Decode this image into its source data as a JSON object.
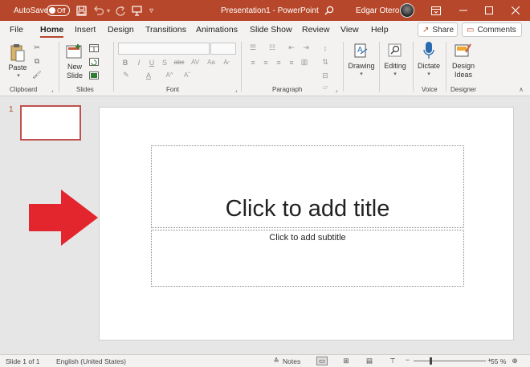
{
  "titlebar": {
    "autosave_label": "AutoSave",
    "autosave_state": "Off",
    "doc_title": "Presentation1  -  PowerPoint",
    "user_name": "Edgar Otero"
  },
  "tabs": [
    {
      "label": "File"
    },
    {
      "label": "Home"
    },
    {
      "label": "Insert"
    },
    {
      "label": "Design"
    },
    {
      "label": "Transitions"
    },
    {
      "label": "Animations"
    },
    {
      "label": "Slide Show"
    },
    {
      "label": "Review"
    },
    {
      "label": "View"
    },
    {
      "label": "Help"
    }
  ],
  "share_label": "Share",
  "comments_label": "Comments",
  "ribbon": {
    "paste": "Paste",
    "new_slide_line1": "New",
    "new_slide_line2": "Slide",
    "drawing": "Drawing",
    "editing": "Editing",
    "dictate": "Dictate",
    "design_ideas_line1": "Design",
    "design_ideas_line2": "Ideas",
    "groups": {
      "clipboard": "Clipboard",
      "slides": "Slides",
      "font": "Font",
      "paragraph": "Paragraph",
      "voice": "Voice",
      "designer": "Designer"
    }
  },
  "thumbnail": {
    "number": "1"
  },
  "slide": {
    "title_placeholder": "Click to add title",
    "subtitle_placeholder": "Click to add subtitle"
  },
  "status": {
    "slide_info": "Slide 1 of 1",
    "language": "English (United States)",
    "notes": "Notes",
    "zoom": "55 %"
  },
  "colors": {
    "accent": "#b7472a",
    "arrow": "#e3252d"
  }
}
